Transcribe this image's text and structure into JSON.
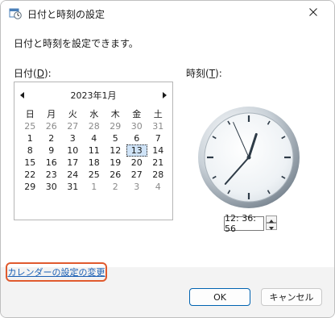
{
  "window": {
    "title": "日付と時刻の設定"
  },
  "content": {
    "description": "日付と時刻を設定できます。",
    "date_label": {
      "text": "日付(",
      "accel": "D",
      "suffix": "):"
    },
    "time_label": {
      "text": "時刻(",
      "accel": "T",
      "suffix": "):"
    }
  },
  "calendar": {
    "title": "2023年1月",
    "weekdays": [
      "日",
      "月",
      "火",
      "水",
      "木",
      "金",
      "土"
    ],
    "weeks": [
      [
        "25",
        "26",
        "27",
        "28",
        "29",
        "30",
        "31"
      ],
      [
        "1",
        "2",
        "3",
        "4",
        "5",
        "6",
        "7"
      ],
      [
        "8",
        "9",
        "10",
        "11",
        "12",
        "13",
        "14"
      ],
      [
        "15",
        "16",
        "17",
        "18",
        "19",
        "20",
        "21"
      ],
      [
        "22",
        "23",
        "24",
        "25",
        "26",
        "27",
        "28"
      ],
      [
        "29",
        "30",
        "31",
        "1",
        "2",
        "3",
        "4"
      ]
    ],
    "selected_day": "13"
  },
  "clock": {
    "hour": 12,
    "minute": 36,
    "second": 56
  },
  "time_field": {
    "value": "12: 36: 56"
  },
  "footer": {
    "calendar_link": "カレンダーの設定の変更",
    "ok_label": "OK",
    "cancel_label": "キャンセル"
  },
  "colors": {
    "accent": "#0063b1",
    "link": "#1a5fb4",
    "highlight_border": "#e05a2e"
  },
  "icons": {
    "title_icon": "date-time-settings-icon",
    "close": "close-icon"
  }
}
